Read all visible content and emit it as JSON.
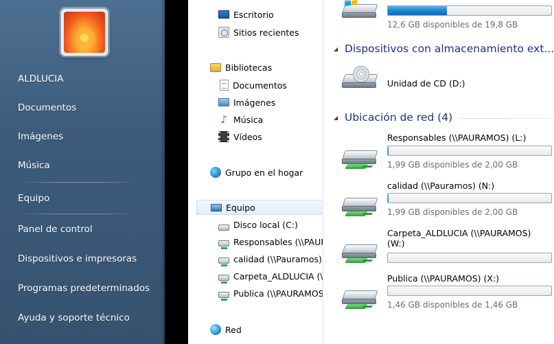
{
  "start_menu": {
    "user_name": "ALDLUCIA",
    "items": [
      {
        "label": "Documentos"
      },
      {
        "label": "Imágenes"
      },
      {
        "label": "Música"
      },
      {
        "label": "Equipo"
      },
      {
        "label": "Panel de control"
      },
      {
        "label": "Dispositivos e impresoras"
      },
      {
        "label": "Programas predeterminados"
      },
      {
        "label": "Ayuda y soporte técnico"
      }
    ]
  },
  "nav": {
    "favorites": [
      {
        "label": "Escritorio",
        "icon": "desktop-icon"
      },
      {
        "label": "Sitios recientes",
        "icon": "recent-places-icon"
      }
    ],
    "libraries": {
      "label": "Bibliotecas",
      "items": [
        {
          "label": "Documentos"
        },
        {
          "label": "Imágenes"
        },
        {
          "label": "Música"
        },
        {
          "label": "Vídeos"
        }
      ]
    },
    "homegroup": {
      "label": "Grupo en el hogar"
    },
    "computer": {
      "label": "Equipo",
      "items": [
        {
          "label": "Disco local (C:)"
        },
        {
          "label": "Responsables (\\\\PAURAMOS) (L:)"
        },
        {
          "label": "calidad (\\\\Pauramos) (N:)"
        },
        {
          "label": "Carpeta_ALDLUCIA (\\\\PAURAMOS) (W:)"
        },
        {
          "label": "Publica (\\\\PAURAMOS) (X:)"
        }
      ]
    },
    "network": {
      "label": "Red"
    }
  },
  "content": {
    "local_disk": {
      "free_text": "12,6 GB disponibles de 19,8 GB",
      "used_fraction": 0.36
    },
    "groups": {
      "removable": {
        "label": "Dispositivos con almacenamiento ext..."
      },
      "network": {
        "label": "Ubicación de red (4)"
      }
    },
    "cd_drive": {
      "name": "Unidad de CD (D:)"
    },
    "network_drives": [
      {
        "name": "Responsables (\\\\PAURAMOS) (L:)",
        "free_text": "1,99 GB disponibles de 2,00 GB",
        "used_fraction": 0.005
      },
      {
        "name": "calidad (\\\\Pauramos) (N:)",
        "free_text": "1,99 GB disponibles de 2,00 GB",
        "used_fraction": 0.005
      },
      {
        "name": "Carpeta_ALDLUCIA (\\\\PAURAMOS) (W:)",
        "free_text": "",
        "used_fraction": 0.0
      },
      {
        "name": "Publica (\\\\PAURAMOS) (X:)",
        "free_text": "1,46 GB disponibles de 1,46 GB",
        "used_fraction": 0.0
      }
    ]
  },
  "colors": {
    "start_menu_bg": "#3c5b7b",
    "group_header": "#1e3287",
    "capacity_fill": "#1f83cf"
  }
}
